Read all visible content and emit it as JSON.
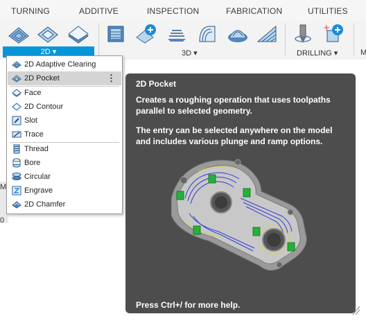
{
  "tabs": [
    "TURNING",
    "ADDITIVE",
    "INSPECTION",
    "FABRICATION",
    "UTILITIES"
  ],
  "groups": {
    "g2d": "2D ▾",
    "g3d": "3D ▾",
    "drilling": "DRILLING ▾",
    "more": "M"
  },
  "menu": {
    "items": [
      {
        "label": "2D Adaptive Clearing",
        "icon": "adaptive-clearing-icon"
      },
      {
        "label": "2D Pocket",
        "icon": "pocket-icon",
        "highlighted": true,
        "more": "⋮"
      },
      {
        "label": "Face",
        "icon": "face-icon"
      },
      {
        "label": "2D Contour",
        "icon": "contour-icon"
      },
      {
        "label": "Slot",
        "icon": "slot-icon"
      },
      {
        "label": "Trace",
        "icon": "trace-icon"
      },
      {
        "label": "Thread",
        "icon": "thread-icon"
      },
      {
        "label": "Bore",
        "icon": "bore-icon"
      },
      {
        "label": "Circular",
        "icon": "circular-icon"
      },
      {
        "label": "Engrave",
        "icon": "engrave-icon"
      },
      {
        "label": "2D Chamfer",
        "icon": "chamfer-icon"
      }
    ]
  },
  "tooltip": {
    "title": "2D Pocket",
    "para1": "Creates a roughing operation that uses toolpaths parallel to selected geometry.",
    "para2": "The entry can be selected anywhere on the model and includes various plunge and ramp options.",
    "help": "Press Ctrl+/ for more help."
  },
  "left_edge": {
    "text1": "Mc",
    "text2": "0"
  },
  "colors": {
    "accent": "#0696d7",
    "tooltip_bg": "#4d4d4d",
    "toolpath": "#2f3dd6",
    "toolpath_green": "#22b33a"
  }
}
